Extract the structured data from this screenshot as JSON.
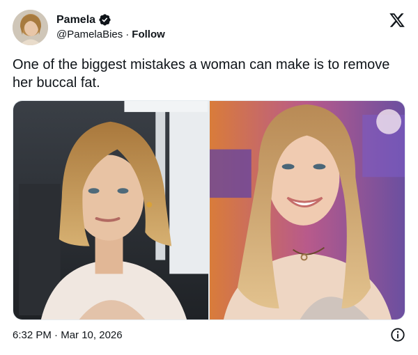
{
  "author": {
    "name": "Pamela",
    "handle": "@PamelaBies",
    "separator": "·",
    "follow_label": "Follow",
    "verified_icon": "verified-badge-icon",
    "avatar": "avatar"
  },
  "tweet": {
    "text": "One of the biggest mistakes a woman can make is to remove her buccal fat."
  },
  "media": {
    "photos": [
      {
        "description_icon": "photo-left"
      },
      {
        "description_icon": "photo-right"
      }
    ]
  },
  "footer": {
    "time": "6:32 PM",
    "separator": "·",
    "date": "Mar 10, 2026"
  },
  "icons": {
    "x_logo": "x-logo-icon",
    "info": "info-icon"
  },
  "colors": {
    "text": "#0f1419",
    "verified_badge": "#0f1419",
    "border": "#e6ecf0"
  }
}
